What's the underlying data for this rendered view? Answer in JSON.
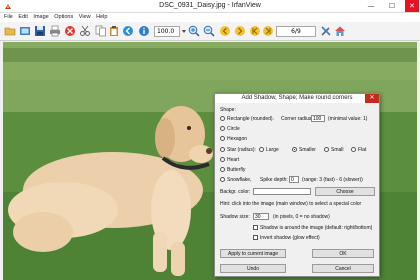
{
  "window": {
    "title": "DSC_0931_Daisy.jpg - IrfanView",
    "minimize": "—",
    "maximize": "☐",
    "close": "✕"
  },
  "menu": [
    "File",
    "Edit",
    "Image",
    "Options",
    "View",
    "Help"
  ],
  "toolbar": {
    "zoom_value": "100.0",
    "page_counter": "6/9"
  },
  "dialog": {
    "title": "Add Shadow, Shape; Make round corners",
    "close": "✕",
    "shape_label": "Shape:",
    "rectangle_label": "Rectangle (rounded).",
    "corner_radius_label": "Corner radius:",
    "corner_radius_value": "100",
    "corner_radius_hint": "(minimal value: 1)",
    "circle_label": "Circle",
    "hexagon_label": "Hexagon",
    "star_label": "Star (radius):",
    "star_large": "Large",
    "star_smaller": "Smaller",
    "star_small": "Small",
    "star_flat": "Flat",
    "heart_label": "Heart",
    "butterfly_label": "Butterfly",
    "snowflake_label": "Snowflake,",
    "spike_depth_label": "Spike depth:",
    "spike_depth_value": "0",
    "spike_depth_hint": "(range: 3 (fast) - 6 (slower))",
    "bkgr_color_label": "Backgr. color:",
    "choose_button": "Choose",
    "hint": "Hint: click into the image (main window) to select a special color",
    "shadow_size_label": "Shadow size:",
    "shadow_size_value": "30",
    "shadow_size_hint": "(in pixels, 0 = no shadow)",
    "shadow_around_label": "Shadow is around the image (default: right/bottom)",
    "invert_shadow_label": "Invert shadow (glow effect)",
    "apply_button": "Apply to current image",
    "ok_button": "OK",
    "undo_button": "Undo",
    "cancel_button": "Cancel",
    "selected_star_size": "Smaller"
  },
  "colors": {
    "close_red": "#e81123",
    "grass_green": "#5e9140",
    "dog_cream": "#e9c9a1"
  }
}
